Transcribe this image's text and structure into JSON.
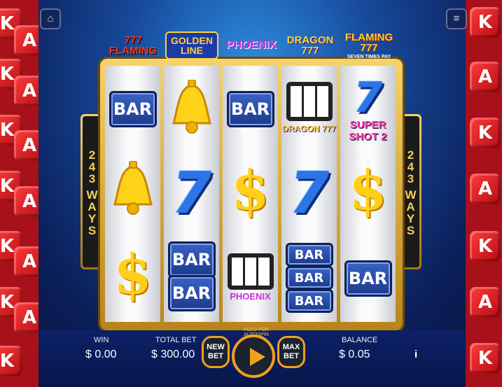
{
  "game_logos": [
    "777 FLAMING",
    "GOLDEN LINE",
    "PHOENIX",
    "DRAGON 777",
    "FLAMING 777"
  ],
  "logo_subtitles": {
    "flaming7": "SEVEN TIMES PAY"
  },
  "ways": {
    "left_number": "243",
    "left_word": "WAYS",
    "right_number": "243",
    "right_word": "WAYS"
  },
  "reels": {
    "reel1": {
      "top": "BAR",
      "bottom_icon": "dollar-sign"
    },
    "reel2": {
      "bottom_top": "BAR",
      "bottom_bottom": "BAR"
    },
    "reel3": {
      "top": "BAR",
      "middle": "$",
      "bottom_logo": "PHOENIX"
    },
    "reel4": {
      "top_logo": "DRAGON 777",
      "bottom_bars": [
        "BAR",
        "BAR",
        "BAR"
      ]
    },
    "reel5": {
      "top_logo": "SUPER SHOT 2",
      "middle": "$",
      "bottom": "BAR"
    }
  },
  "glyphs": {
    "dollar": "$",
    "seven": "7",
    "bell": "🔔",
    "home": "⌂",
    "menu": "≡",
    "info": "i"
  },
  "dice_letters": [
    "K",
    "A"
  ],
  "hud": {
    "win_label": "WIN",
    "win_value": "$ 0.00",
    "total_bet_label": "TOTAL BET",
    "total_bet_value": "$ 300.00",
    "new_bet_label": "NEW BET",
    "max_bet_label": "MAX BET",
    "hold_label": "HOLD FOR AUTOSPIN",
    "balance_label": "BALANCE",
    "balance_value": "$ 0.05",
    "info_label": "i"
  },
  "colors": {
    "accent": "#f0a020",
    "reel_bg": "#fbfbfc",
    "dice_red": "#d11a22"
  }
}
